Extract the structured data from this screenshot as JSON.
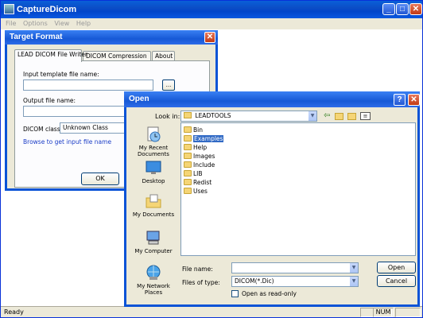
{
  "app": {
    "title": "CaptureDicom",
    "menu": [
      "File",
      "Options",
      "View",
      "Help"
    ],
    "status_text": "Ready",
    "status_num": "NUM"
  },
  "target_dialog": {
    "title": "Target Format",
    "tabs": [
      "LEAD DICOM File Writer",
      "DICOM Compression",
      "About"
    ],
    "input_template_label": "Input template file name:",
    "input_template_value": "",
    "browse_button": "...",
    "output_label": "Output file name:",
    "output_value": "",
    "dicom_class_label": "DICOM class",
    "dicom_class_value": "Unknown Class",
    "browse_link": "Browse to get input file name",
    "ok_label": "OK"
  },
  "open_dialog": {
    "title": "Open",
    "help_icon": "?",
    "look_in_label": "Look in:",
    "look_in_value": "LEADTOOLS",
    "places": [
      "My Recent Documents",
      "Desktop",
      "My Documents",
      "My Computer",
      "My Network Places"
    ],
    "folders": [
      "Bin",
      "Examples",
      "Help",
      "Images",
      "Include",
      "LIB",
      "Redist",
      "Uses"
    ],
    "selected_folder": "Examples",
    "file_name_label": "File name:",
    "file_name_value": "",
    "file_type_label": "Files of type:",
    "file_type_value": "DICOM(*.Dic)",
    "read_only_label": "Open as read-only",
    "open_button": "Open",
    "cancel_button": "Cancel"
  },
  "colors": {
    "xp_blue": "#0a53d6",
    "dialog_face": "#ece9d8",
    "selection": "#316ac5",
    "link": "#1a3cc7"
  }
}
